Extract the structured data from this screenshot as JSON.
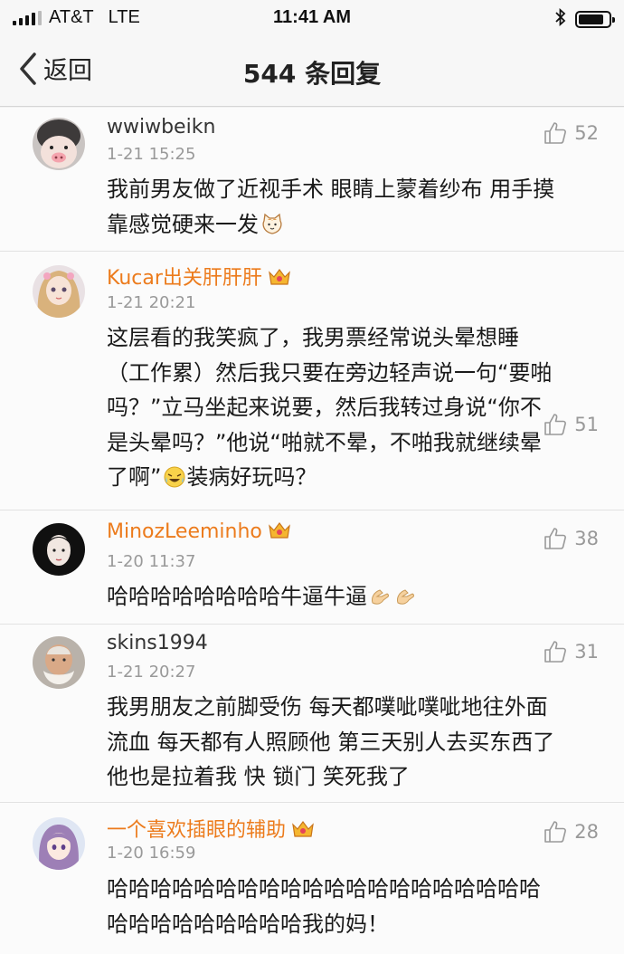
{
  "status_bar": {
    "carrier": "AT&T",
    "network": "LTE",
    "time": "11:41 AM",
    "battery_level": 0.85
  },
  "nav": {
    "back_label": "返回",
    "title": "544 条回复"
  },
  "comments": [
    {
      "username": "wwiwbeikn",
      "time": "1-21 15:25",
      "likes": "52",
      "vip": false,
      "lines": [
        "我前男友做了近视手术 眼睛上蒙着纱布 用手摸",
        "靠感觉硬来一发"
      ],
      "avatar": "pig-face-avatar",
      "emoji": "cat-face-icon"
    },
    {
      "username": "Kucar出关肝肝肝",
      "time": "1-21 20:21",
      "likes": "51",
      "vip": true,
      "lines": [
        "这层看的我笑疯了，我男票经常说头晕想睡",
        "（工作累）然后我只要在旁边轻声说一句“要啪",
        "吗？”立马坐起来说要，然后我转过身说“你不",
        "是头晕吗？”他说“啪就不晕，不啪我就继续晕",
        "了啊”",
        "装病好玩吗？"
      ],
      "avatar": "doll-avatar",
      "emoji": "laugh-cry-emoji"
    },
    {
      "username": "MinozLeeminho",
      "time": "1-20 11:37",
      "likes": "38",
      "vip": true,
      "lines": [
        "哈哈哈哈哈哈哈哈牛逼牛逼"
      ],
      "avatar": "woman-portrait-avatar",
      "emoji": "clap-hands-emoji"
    },
    {
      "username": "skins1994",
      "time": "1-21 20:27",
      "likes": "31",
      "vip": false,
      "lines": [
        "我男朋友之前脚受伤 每天都噗呲噗呲地往外面",
        "流血 每天都有人照顾他 第三天别人去买东西了",
        "他也是拉着我 快 锁门 笑死我了"
      ],
      "avatar": "old-man-avatar"
    },
    {
      "username": "一个喜欢插眼的辅助",
      "time": "1-20 16:59",
      "likes": "28",
      "vip": true,
      "lines": [
        "哈哈哈哈哈哈哈哈哈哈哈哈哈哈哈哈哈哈哈哈",
        "哈哈哈哈哈哈哈哈哈我的妈！"
      ],
      "avatar": "anime-girl-avatar"
    }
  ],
  "colors": {
    "vip_name": "#ec7b1c",
    "meta_gray": "#999999",
    "crown": "#f0a020"
  }
}
